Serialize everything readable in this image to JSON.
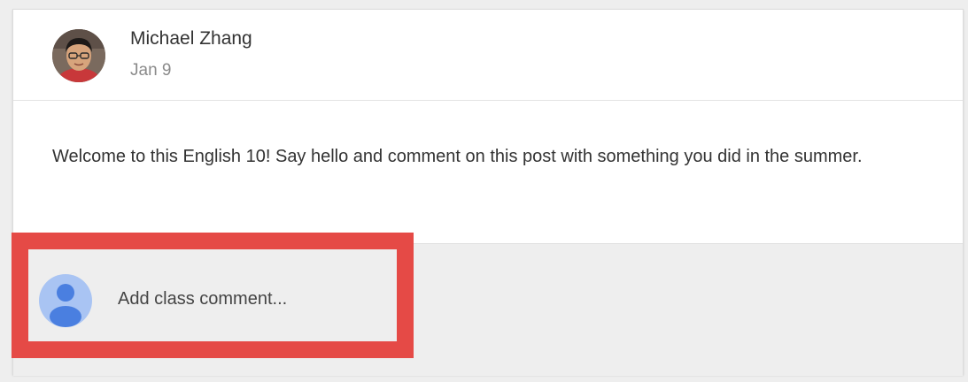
{
  "post": {
    "author_name": "Michael Zhang",
    "date": "Jan 9",
    "body": "Welcome to this English 10! Say hello and comment on this post with something you did in the summer."
  },
  "comment": {
    "placeholder": "Add class comment..."
  },
  "colors": {
    "highlight": "#e54a46",
    "comment_bg": "#eeeeee",
    "user_avatar_bg": "#a9c4f3",
    "user_avatar_fg": "#4a7fe0"
  },
  "icons": {
    "author_avatar": "profile-photo",
    "user_avatar": "person-icon"
  }
}
